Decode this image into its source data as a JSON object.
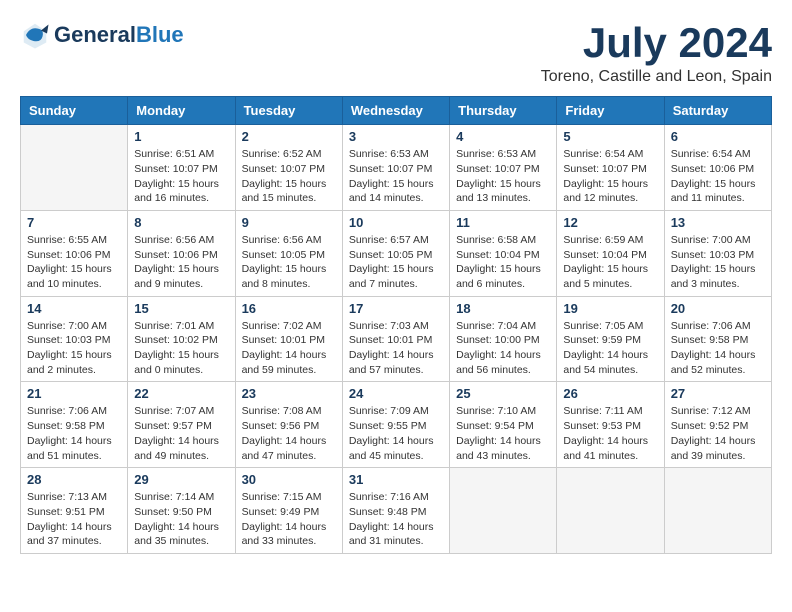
{
  "header": {
    "logo_line1": "General",
    "logo_line2": "Blue",
    "month": "July 2024",
    "location": "Toreno, Castille and Leon, Spain"
  },
  "calendar": {
    "days_of_week": [
      "Sunday",
      "Monday",
      "Tuesday",
      "Wednesday",
      "Thursday",
      "Friday",
      "Saturday"
    ],
    "weeks": [
      [
        {
          "day": "",
          "info": ""
        },
        {
          "day": "1",
          "info": "Sunrise: 6:51 AM\nSunset: 10:07 PM\nDaylight: 15 hours\nand 16 minutes."
        },
        {
          "day": "2",
          "info": "Sunrise: 6:52 AM\nSunset: 10:07 PM\nDaylight: 15 hours\nand 15 minutes."
        },
        {
          "day": "3",
          "info": "Sunrise: 6:53 AM\nSunset: 10:07 PM\nDaylight: 15 hours\nand 14 minutes."
        },
        {
          "day": "4",
          "info": "Sunrise: 6:53 AM\nSunset: 10:07 PM\nDaylight: 15 hours\nand 13 minutes."
        },
        {
          "day": "5",
          "info": "Sunrise: 6:54 AM\nSunset: 10:07 PM\nDaylight: 15 hours\nand 12 minutes."
        },
        {
          "day": "6",
          "info": "Sunrise: 6:54 AM\nSunset: 10:06 PM\nDaylight: 15 hours\nand 11 minutes."
        }
      ],
      [
        {
          "day": "7",
          "info": "Sunrise: 6:55 AM\nSunset: 10:06 PM\nDaylight: 15 hours\nand 10 minutes."
        },
        {
          "day": "8",
          "info": "Sunrise: 6:56 AM\nSunset: 10:06 PM\nDaylight: 15 hours\nand 9 minutes."
        },
        {
          "day": "9",
          "info": "Sunrise: 6:56 AM\nSunset: 10:05 PM\nDaylight: 15 hours\nand 8 minutes."
        },
        {
          "day": "10",
          "info": "Sunrise: 6:57 AM\nSunset: 10:05 PM\nDaylight: 15 hours\nand 7 minutes."
        },
        {
          "day": "11",
          "info": "Sunrise: 6:58 AM\nSunset: 10:04 PM\nDaylight: 15 hours\nand 6 minutes."
        },
        {
          "day": "12",
          "info": "Sunrise: 6:59 AM\nSunset: 10:04 PM\nDaylight: 15 hours\nand 5 minutes."
        },
        {
          "day": "13",
          "info": "Sunrise: 7:00 AM\nSunset: 10:03 PM\nDaylight: 15 hours\nand 3 minutes."
        }
      ],
      [
        {
          "day": "14",
          "info": "Sunrise: 7:00 AM\nSunset: 10:03 PM\nDaylight: 15 hours\nand 2 minutes."
        },
        {
          "day": "15",
          "info": "Sunrise: 7:01 AM\nSunset: 10:02 PM\nDaylight: 15 hours\nand 0 minutes."
        },
        {
          "day": "16",
          "info": "Sunrise: 7:02 AM\nSunset: 10:01 PM\nDaylight: 14 hours\nand 59 minutes."
        },
        {
          "day": "17",
          "info": "Sunrise: 7:03 AM\nSunset: 10:01 PM\nDaylight: 14 hours\nand 57 minutes."
        },
        {
          "day": "18",
          "info": "Sunrise: 7:04 AM\nSunset: 10:00 PM\nDaylight: 14 hours\nand 56 minutes."
        },
        {
          "day": "19",
          "info": "Sunrise: 7:05 AM\nSunset: 9:59 PM\nDaylight: 14 hours\nand 54 minutes."
        },
        {
          "day": "20",
          "info": "Sunrise: 7:06 AM\nSunset: 9:58 PM\nDaylight: 14 hours\nand 52 minutes."
        }
      ],
      [
        {
          "day": "21",
          "info": "Sunrise: 7:06 AM\nSunset: 9:58 PM\nDaylight: 14 hours\nand 51 minutes."
        },
        {
          "day": "22",
          "info": "Sunrise: 7:07 AM\nSunset: 9:57 PM\nDaylight: 14 hours\nand 49 minutes."
        },
        {
          "day": "23",
          "info": "Sunrise: 7:08 AM\nSunset: 9:56 PM\nDaylight: 14 hours\nand 47 minutes."
        },
        {
          "day": "24",
          "info": "Sunrise: 7:09 AM\nSunset: 9:55 PM\nDaylight: 14 hours\nand 45 minutes."
        },
        {
          "day": "25",
          "info": "Sunrise: 7:10 AM\nSunset: 9:54 PM\nDaylight: 14 hours\nand 43 minutes."
        },
        {
          "day": "26",
          "info": "Sunrise: 7:11 AM\nSunset: 9:53 PM\nDaylight: 14 hours\nand 41 minutes."
        },
        {
          "day": "27",
          "info": "Sunrise: 7:12 AM\nSunset: 9:52 PM\nDaylight: 14 hours\nand 39 minutes."
        }
      ],
      [
        {
          "day": "28",
          "info": "Sunrise: 7:13 AM\nSunset: 9:51 PM\nDaylight: 14 hours\nand 37 minutes."
        },
        {
          "day": "29",
          "info": "Sunrise: 7:14 AM\nSunset: 9:50 PM\nDaylight: 14 hours\nand 35 minutes."
        },
        {
          "day": "30",
          "info": "Sunrise: 7:15 AM\nSunset: 9:49 PM\nDaylight: 14 hours\nand 33 minutes."
        },
        {
          "day": "31",
          "info": "Sunrise: 7:16 AM\nSunset: 9:48 PM\nDaylight: 14 hours\nand 31 minutes."
        },
        {
          "day": "",
          "info": ""
        },
        {
          "day": "",
          "info": ""
        },
        {
          "day": "",
          "info": ""
        }
      ]
    ]
  }
}
